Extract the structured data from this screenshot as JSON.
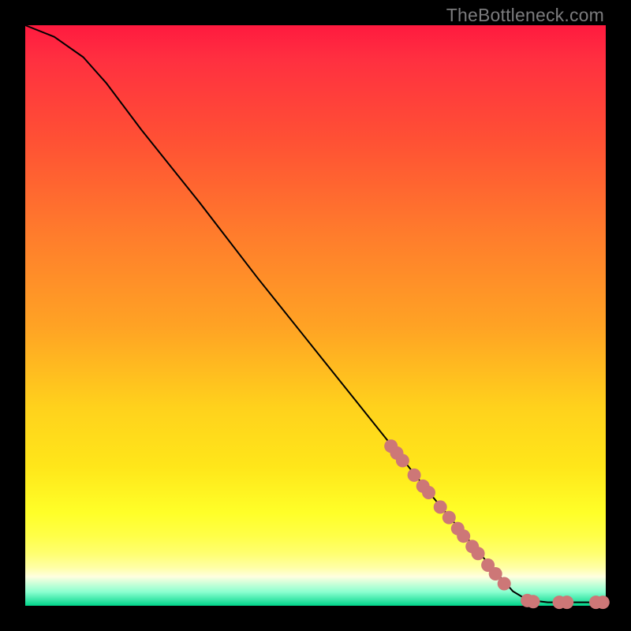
{
  "watermark": "TheBottleneck.com",
  "colors": {
    "background": "#000000",
    "curve": "#000000",
    "dot": "#cd7777",
    "gradient_top": "#ff1a3f",
    "gradient_bottom": "#00d58a"
  },
  "chart_data": {
    "type": "line",
    "title": "",
    "xlabel": "",
    "ylabel": "",
    "xlim": [
      0,
      100
    ],
    "ylim": [
      0,
      100
    ],
    "curve": [
      {
        "x": 0.0,
        "y": 100.0
      },
      {
        "x": 5.0,
        "y": 98.0
      },
      {
        "x": 10.0,
        "y": 94.5
      },
      {
        "x": 14.0,
        "y": 90.0
      },
      {
        "x": 20.0,
        "y": 82.0
      },
      {
        "x": 30.0,
        "y": 69.5
      },
      {
        "x": 40.0,
        "y": 56.5
      },
      {
        "x": 50.0,
        "y": 44.0
      },
      {
        "x": 60.0,
        "y": 31.5
      },
      {
        "x": 70.0,
        "y": 19.0
      },
      {
        "x": 80.0,
        "y": 7.0
      },
      {
        "x": 84.0,
        "y": 2.5
      },
      {
        "x": 86.5,
        "y": 1.0
      },
      {
        "x": 90.0,
        "y": 0.6
      },
      {
        "x": 95.0,
        "y": 0.6
      },
      {
        "x": 100.0,
        "y": 0.6
      }
    ],
    "series": [
      {
        "name": "highlighted-points",
        "points": [
          {
            "x": 63.0,
            "y": 27.5
          },
          {
            "x": 64.0,
            "y": 26.3
          },
          {
            "x": 65.0,
            "y": 25.0
          },
          {
            "x": 67.0,
            "y": 22.5
          },
          {
            "x": 68.5,
            "y": 20.6
          },
          {
            "x": 69.5,
            "y": 19.5
          },
          {
            "x": 71.5,
            "y": 17.0
          },
          {
            "x": 73.0,
            "y": 15.2
          },
          {
            "x": 74.5,
            "y": 13.3
          },
          {
            "x": 75.5,
            "y": 12.0
          },
          {
            "x": 77.0,
            "y": 10.2
          },
          {
            "x": 78.0,
            "y": 9.0
          },
          {
            "x": 79.7,
            "y": 7.0
          },
          {
            "x": 81.0,
            "y": 5.5
          },
          {
            "x": 82.5,
            "y": 3.8
          },
          {
            "x": 86.5,
            "y": 0.9
          },
          {
            "x": 87.5,
            "y": 0.7
          },
          {
            "x": 92.0,
            "y": 0.6
          },
          {
            "x": 93.3,
            "y": 0.6
          },
          {
            "x": 98.3,
            "y": 0.6
          },
          {
            "x": 99.5,
            "y": 0.6
          }
        ]
      }
    ]
  }
}
